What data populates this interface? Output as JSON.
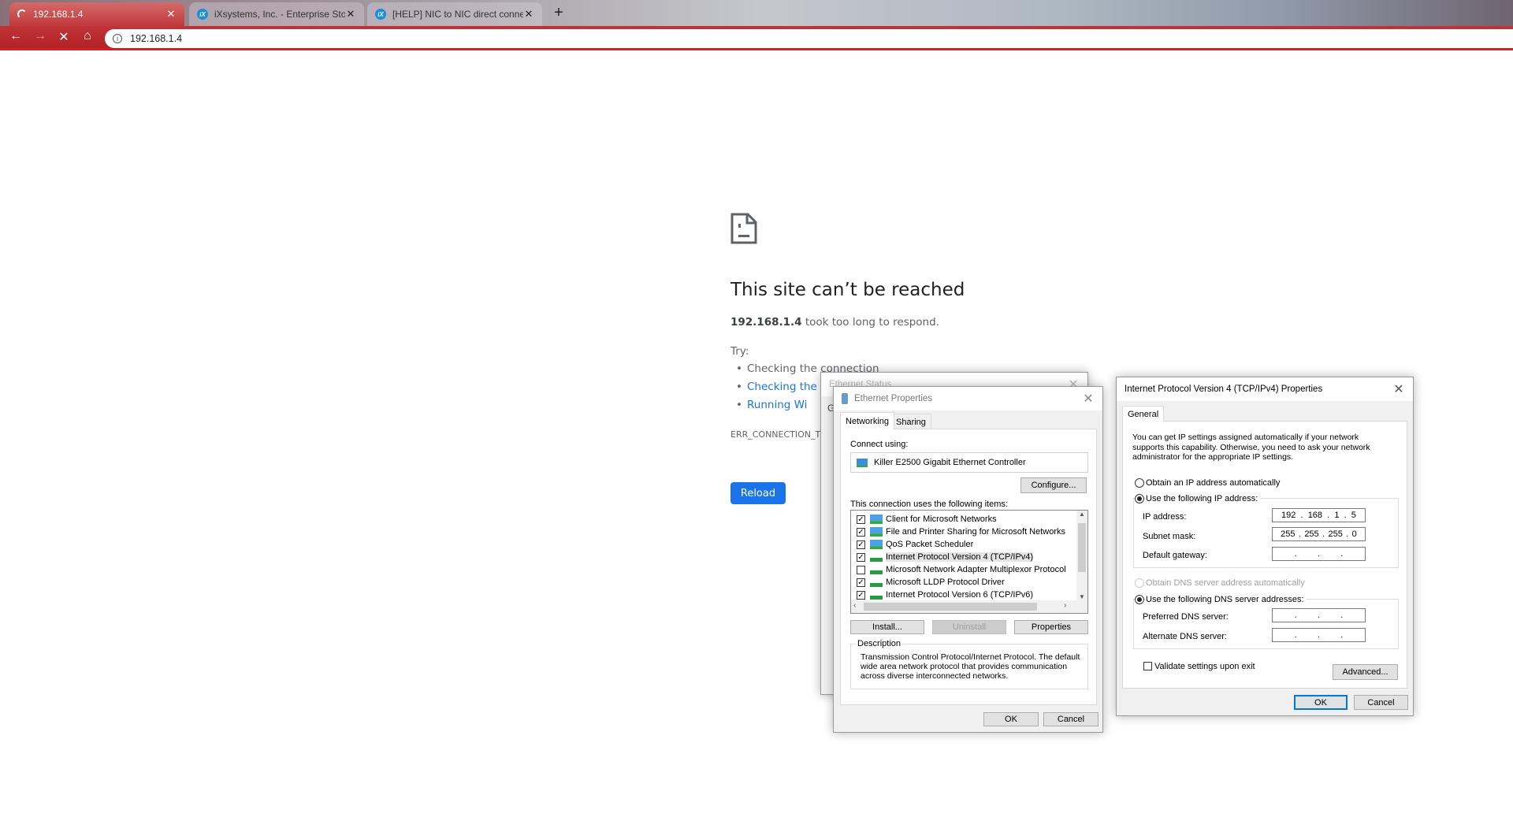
{
  "browser": {
    "tabs": [
      {
        "title": "192.168.1.4",
        "icon": "loading-spinner-icon",
        "active": true
      },
      {
        "title": "iXsystems, Inc. - Enterprise Storag",
        "icon": "ixsystems-logo-icon"
      },
      {
        "title": "[HELP] NIC to NIC direct connecti",
        "icon": "ixsystems-logo-icon"
      }
    ],
    "new_tab": "+",
    "close": "✕",
    "address": "192.168.1.4",
    "theme_color": "#c0343a"
  },
  "error_page": {
    "title": "This site can’t be reached",
    "host": "192.168.1.4",
    "message": " took too long to respond.",
    "try_label": "Try:",
    "suggestions": [
      "Checking the connection",
      "Checking the",
      "Running Wi"
    ],
    "error_code": "ERR_CONNECTION_TIM",
    "reload": "Reload",
    "link_color": "#1a73e8"
  },
  "ethernet_status": {
    "title": "Ethernet Status",
    "tab_fragment": "G"
  },
  "ethernet_properties": {
    "title": "Ethernet Properties",
    "tabs": [
      "Networking",
      "Sharing"
    ],
    "connect_using_label": "Connect using:",
    "adapter": "Killer E2500 Gigabit Ethernet Controller",
    "configure": "Configure...",
    "items_label": "This connection uses the following items:",
    "items": [
      {
        "label": "Client for Microsoft Networks",
        "checked": true,
        "icon": "network-client-icon"
      },
      {
        "label": "File and Printer Sharing for Microsoft Networks",
        "checked": true,
        "icon": "network-client-icon"
      },
      {
        "label": "QoS Packet Scheduler",
        "checked": true,
        "icon": "network-client-icon"
      },
      {
        "label": "Internet Protocol Version 4 (TCP/IPv4)",
        "checked": true,
        "icon": "protocol-icon",
        "selected": true
      },
      {
        "label": "Microsoft Network Adapter Multiplexor Protocol",
        "checked": false,
        "icon": "protocol-icon"
      },
      {
        "label": "Microsoft LLDP Protocol Driver",
        "checked": true,
        "icon": "protocol-icon"
      },
      {
        "label": "Internet Protocol Version 6 (TCP/IPv6)",
        "checked": true,
        "icon": "protocol-icon"
      }
    ],
    "install": "Install...",
    "uninstall": "Uninstall",
    "properties": "Properties",
    "description_label": "Description",
    "description": "Transmission Control Protocol/Internet Protocol. The default wide area network protocol that provides communication across diverse interconnected networks.",
    "ok": "OK",
    "cancel": "Cancel"
  },
  "ipv4": {
    "title": "Internet Protocol Version 4 (TCP/IPv4) Properties",
    "tab": "General",
    "intro": "You can get IP settings assigned automatically if your network supports this capability. Otherwise, you need to ask your network administrator for the appropriate IP settings.",
    "obtain_ip_auto": "Obtain an IP address automatically",
    "use_ip": "Use the following IP address:",
    "ip_label": "IP address:",
    "ip": [
      "192",
      "168",
      "1",
      "5"
    ],
    "mask_label": "Subnet mask:",
    "mask": [
      "255",
      "255",
      "255",
      "0"
    ],
    "gateway_label": "Default gateway:",
    "gateway": [
      "",
      "",
      "",
      ""
    ],
    "obtain_dns_auto": "Obtain DNS server address automatically",
    "use_dns": "Use the following DNS server addresses:",
    "pref_dns_label": "Preferred DNS server:",
    "pref_dns": [
      "",
      "",
      "",
      ""
    ],
    "alt_dns_label": "Alternate DNS server:",
    "alt_dns": [
      "",
      "",
      "",
      ""
    ],
    "validate": "Validate settings upon exit",
    "validate_checked": false,
    "advanced": "Advanced...",
    "ok": "OK",
    "cancel": "Cancel"
  }
}
